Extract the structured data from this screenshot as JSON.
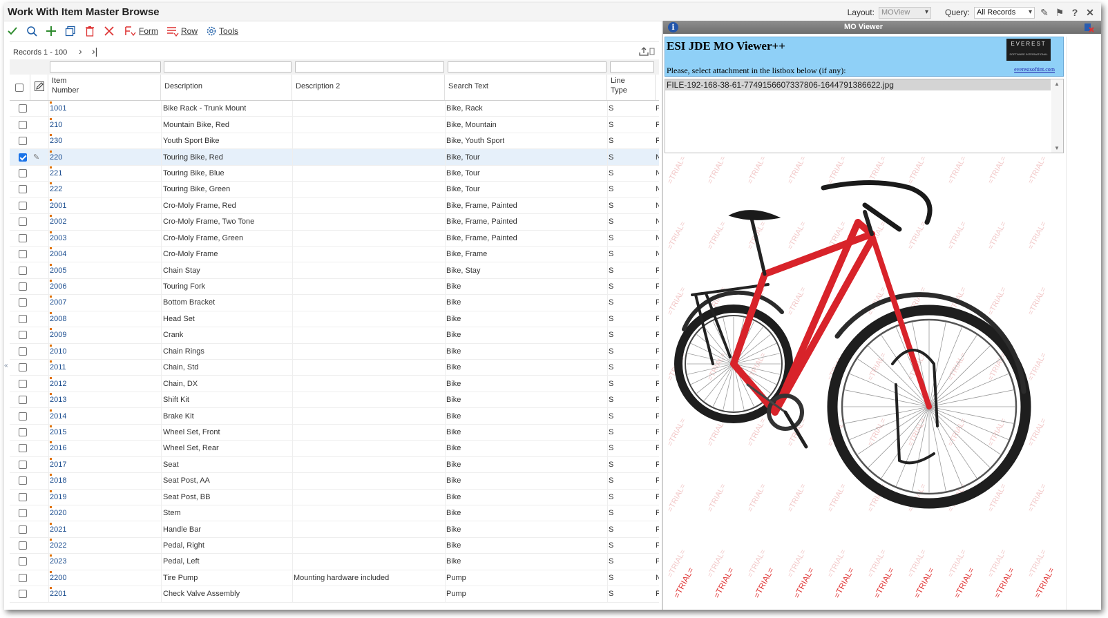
{
  "window": {
    "title": "Work With Item Master Browse",
    "layout_label": "Layout:",
    "layout_value": "MOView",
    "query_label": "Query:",
    "query_value": "All Records"
  },
  "toolbar": {
    "icons": [
      "check-icon",
      "search-icon",
      "add-icon",
      "copy-icon",
      "delete-icon",
      "close-icon"
    ],
    "form_label": "Form",
    "row_label": "Row",
    "tools_label": "Tools"
  },
  "records": {
    "label": "Records 1 - 100"
  },
  "grid": {
    "columns": [
      {
        "key": "item",
        "label_line1": "Item",
        "label_line2": "Number"
      },
      {
        "key": "desc",
        "label_line1": "Description",
        "label_line2": ""
      },
      {
        "key": "desc2",
        "label_line1": "Description 2",
        "label_line2": ""
      },
      {
        "key": "search",
        "label_line1": "Search Text",
        "label_line2": ""
      },
      {
        "key": "line",
        "label_line1": "Line",
        "label_line2": "Type"
      }
    ],
    "rows": [
      {
        "item": "1001",
        "desc": "Bike Rack - Trunk Mount",
        "desc2": "",
        "search": "Bike, Rack",
        "line": "S",
        "next": "F",
        "selected": false
      },
      {
        "item": "210",
        "desc": "Mountain Bike, Red",
        "desc2": "",
        "search": "Bike, Mountain",
        "line": "S",
        "next": "F",
        "selected": false
      },
      {
        "item": "230",
        "desc": "Youth Sport Bike",
        "desc2": "",
        "search": "Bike, Youth Sport",
        "line": "S",
        "next": "F",
        "selected": false
      },
      {
        "item": "220",
        "desc": "Touring Bike, Red",
        "desc2": "",
        "search": "Bike, Tour",
        "line": "S",
        "next": "N",
        "selected": true
      },
      {
        "item": "221",
        "desc": "Touring Bike, Blue",
        "desc2": "",
        "search": "Bike, Tour",
        "line": "S",
        "next": "N",
        "selected": false
      },
      {
        "item": "222",
        "desc": "Touring Bike, Green",
        "desc2": "",
        "search": "Bike, Tour",
        "line": "S",
        "next": "N",
        "selected": false
      },
      {
        "item": "2001",
        "desc": "Cro-Moly Frame, Red",
        "desc2": "",
        "search": "Bike, Frame, Painted",
        "line": "S",
        "next": "N",
        "selected": false
      },
      {
        "item": "2002",
        "desc": "Cro-Moly Frame, Two Tone",
        "desc2": "",
        "search": "Bike, Frame, Painted",
        "line": "S",
        "next": "N",
        "selected": false
      },
      {
        "item": "2003",
        "desc": "Cro-Moly Frame, Green",
        "desc2": "",
        "search": "Bike, Frame, Painted",
        "line": "S",
        "next": "N",
        "selected": false
      },
      {
        "item": "2004",
        "desc": "Cro-Moly Frame",
        "desc2": "",
        "search": "Bike, Frame",
        "line": "S",
        "next": "N",
        "selected": false
      },
      {
        "item": "2005",
        "desc": "Chain Stay",
        "desc2": "",
        "search": "Bike, Stay",
        "line": "S",
        "next": "F",
        "selected": false
      },
      {
        "item": "2006",
        "desc": "Touring Fork",
        "desc2": "",
        "search": "Bike",
        "line": "S",
        "next": "F",
        "selected": false
      },
      {
        "item": "2007",
        "desc": "Bottom Bracket",
        "desc2": "",
        "search": "Bike",
        "line": "S",
        "next": "F",
        "selected": false
      },
      {
        "item": "2008",
        "desc": "Head Set",
        "desc2": "",
        "search": "Bike",
        "line": "S",
        "next": "F",
        "selected": false
      },
      {
        "item": "2009",
        "desc": "Crank",
        "desc2": "",
        "search": "Bike",
        "line": "S",
        "next": "F",
        "selected": false
      },
      {
        "item": "2010",
        "desc": "Chain Rings",
        "desc2": "",
        "search": "Bike",
        "line": "S",
        "next": "F",
        "selected": false
      },
      {
        "item": "2011",
        "desc": "Chain, Std",
        "desc2": "",
        "search": "Bike",
        "line": "S",
        "next": "F",
        "selected": false
      },
      {
        "item": "2012",
        "desc": "Chain, DX",
        "desc2": "",
        "search": "Bike",
        "line": "S",
        "next": "F",
        "selected": false
      },
      {
        "item": "2013",
        "desc": "Shift Kit",
        "desc2": "",
        "search": "Bike",
        "line": "S",
        "next": "F",
        "selected": false
      },
      {
        "item": "2014",
        "desc": "Brake Kit",
        "desc2": "",
        "search": "Bike",
        "line": "S",
        "next": "F",
        "selected": false
      },
      {
        "item": "2015",
        "desc": "Wheel Set, Front",
        "desc2": "",
        "search": "Bike",
        "line": "S",
        "next": "F",
        "selected": false
      },
      {
        "item": "2016",
        "desc": "Wheel Set, Rear",
        "desc2": "",
        "search": "Bike",
        "line": "S",
        "next": "F",
        "selected": false
      },
      {
        "item": "2017",
        "desc": "Seat",
        "desc2": "",
        "search": "Bike",
        "line": "S",
        "next": "F",
        "selected": false
      },
      {
        "item": "2018",
        "desc": "Seat Post, AA",
        "desc2": "",
        "search": "Bike",
        "line": "S",
        "next": "F",
        "selected": false
      },
      {
        "item": "2019",
        "desc": "Seat Post, BB",
        "desc2": "",
        "search": "Bike",
        "line": "S",
        "next": "F",
        "selected": false
      },
      {
        "item": "2020",
        "desc": "Stem",
        "desc2": "",
        "search": "Bike",
        "line": "S",
        "next": "F",
        "selected": false
      },
      {
        "item": "2021",
        "desc": "Handle Bar",
        "desc2": "",
        "search": "Bike",
        "line": "S",
        "next": "F",
        "selected": false
      },
      {
        "item": "2022",
        "desc": "Pedal, Right",
        "desc2": "",
        "search": "Bike",
        "line": "S",
        "next": "F",
        "selected": false
      },
      {
        "item": "2023",
        "desc": "Pedal, Left",
        "desc2": "",
        "search": "Bike",
        "line": "S",
        "next": "F",
        "selected": false
      },
      {
        "item": "2200",
        "desc": "Tire Pump",
        "desc2": "Mounting hardware included",
        "search": "Pump",
        "line": "S",
        "next": "N",
        "selected": false
      },
      {
        "item": "2201",
        "desc": "Check Valve Assembly",
        "desc2": "",
        "search": "Pump",
        "line": "S",
        "next": "F",
        "selected": false
      }
    ]
  },
  "mo_viewer": {
    "title": "MO Viewer",
    "heading": "ESI JDE MO Viewer++",
    "prompt": "Please, select attachment in the listbox below (if any):",
    "logo_text": "EVEREST",
    "logo_sub": "SOFTWARE INTERNATIONAL",
    "link_text": "everestsoftint.com",
    "attachment": "FILE-192-168-38-61-7749156607337806-1644791386622.jpg",
    "watermark": "=TRIAL=",
    "colors": {
      "frame_red": "#d8232a",
      "header_blue": "#8fd0f7"
    }
  }
}
